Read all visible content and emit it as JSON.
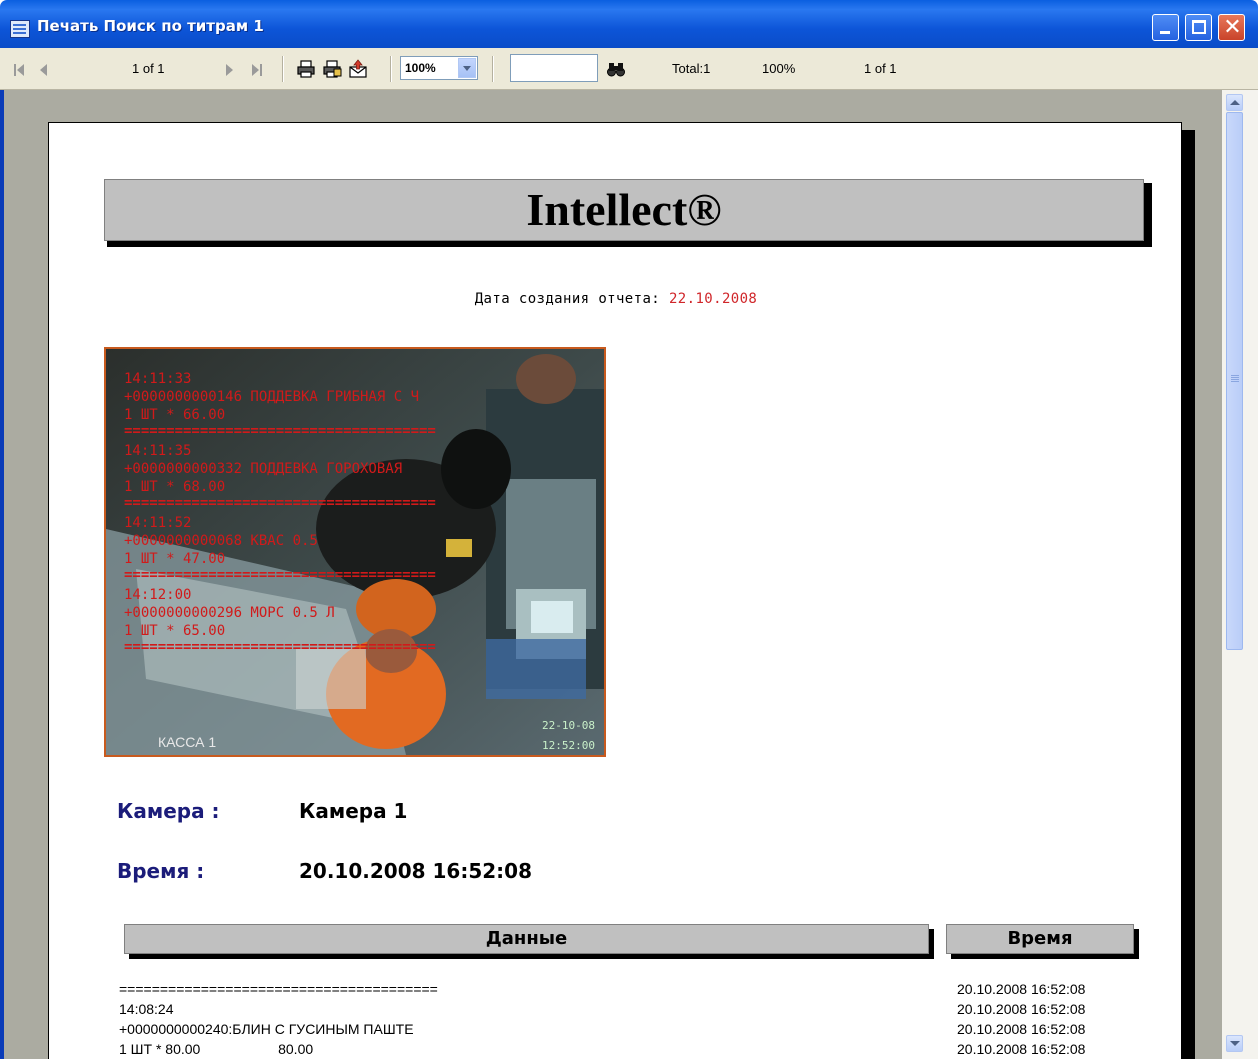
{
  "window": {
    "title": "Печать Поиск по титрам 1"
  },
  "toolbar": {
    "page_indicator": "1 of 1",
    "zoom_value": "100%",
    "search_value": "",
    "total": "Total:1",
    "zoom_percent": "100%",
    "page_of": "1 of 1",
    "icons": [
      "first-page-icon",
      "prev-page-icon",
      "next-page-icon",
      "last-page-icon",
      "print-icon",
      "print-setup-icon",
      "export-icon",
      "find-icon"
    ]
  },
  "report": {
    "brand": "Intellect®",
    "date_label": "Дата создания отчета:",
    "date_value": "22.10.2008",
    "image_overlay": {
      "lines": [
        "14:11:33",
        "+0000000000146 ПОДДЕВКА ГРИБНАЯ С Ч",
        "1 ШТ * 66.00",
        "14:11:35",
        "+0000000000332 ПОДДЕВКА ГОРОХОВАЯ",
        "1 ШТ * 68.00",
        "14:11:52",
        "+0000000000068 КВАС 0.5",
        "1 ШТ * 47.00",
        "14:12:00",
        "+0000000000296 МОРС 0.5 Л",
        "1 ШТ * 65.00"
      ],
      "camera_caption": "КАССА 1",
      "stamp_date": "22-10-08",
      "stamp_time": "12:52:00"
    },
    "camera_label": "Камера :",
    "camera_value": "Камера 1",
    "time_label": "Время :",
    "time_value": "20.10.2008 16:52:08",
    "columns": {
      "data": "Данные",
      "time": "Время"
    },
    "rows": [
      {
        "data": "=======================================",
        "time": "20.10.2008 16:52:08"
      },
      {
        "data": "14:08:24",
        "time": "20.10.2008 16:52:08"
      },
      {
        "data": "+0000000000240:БЛИН С ГУСИНЫМ ПАШТЕ",
        "time": "20.10.2008 16:52:08"
      },
      {
        "data": "1 ШТ * 80.00                    80.00",
        "time": "20.10.2008 16:52:08"
      }
    ]
  }
}
